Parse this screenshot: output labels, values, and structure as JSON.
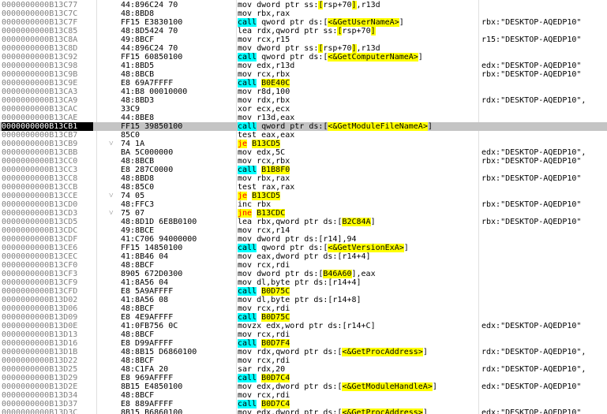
{
  "view": "disassembly",
  "selected_address": "0000000000B13CB1",
  "colors": {
    "call_highlight": "#00ffff",
    "jump_highlight": "#ffff00",
    "selected_row": "#c4c4c4",
    "selected_address_bg": "#000000"
  },
  "rows": [
    {
      "addr": "0000000000B13C77",
      "arrow": "",
      "bytes": "44:896C24 70",
      "instr": [
        {
          "t": "mov dword ptr ss:"
        },
        {
          "t": "[",
          "h": "sbr"
        },
        {
          "t": "rsp+70"
        },
        {
          "t": "]",
          "h": "sbr"
        },
        {
          "t": ",r13d"
        }
      ],
      "comment": ""
    },
    {
      "addr": "0000000000B13C7C",
      "arrow": "",
      "bytes": "48:8BD8",
      "instr": [
        {
          "t": "mov rbx,rax"
        }
      ],
      "comment": ""
    },
    {
      "addr": "0000000000B13C7F",
      "arrow": "",
      "bytes": "FF15 E3830100",
      "instr": [
        {
          "t": "call",
          "h": "call"
        },
        {
          "t": " qword ptr ds:["
        },
        {
          "t": "<&GetUserNameA>",
          "h": "ref"
        },
        {
          "t": "]"
        }
      ],
      "comment": "rbx:\"DESKTOP-AQEDP10\""
    },
    {
      "addr": "0000000000B13C85",
      "arrow": "",
      "bytes": "48:8D5424 70",
      "instr": [
        {
          "t": "lea rdx,qword ptr ss:"
        },
        {
          "t": "[",
          "h": "sbr"
        },
        {
          "t": "rsp+70"
        },
        {
          "t": "]",
          "h": "sbr"
        }
      ],
      "comment": ""
    },
    {
      "addr": "0000000000B13C8A",
      "arrow": "",
      "bytes": "49:8BCF",
      "instr": [
        {
          "t": "mov rcx,r15"
        }
      ],
      "comment": "r15:\"DESKTOP-AQEDP10\""
    },
    {
      "addr": "0000000000B13C8D",
      "arrow": "",
      "bytes": "44:896C24 70",
      "instr": [
        {
          "t": "mov dword ptr ss:"
        },
        {
          "t": "[",
          "h": "sbr"
        },
        {
          "t": "rsp+70"
        },
        {
          "t": "]",
          "h": "sbr"
        },
        {
          "t": ",r13d"
        }
      ],
      "comment": ""
    },
    {
      "addr": "0000000000B13C92",
      "arrow": "",
      "bytes": "FF15 60850100",
      "instr": [
        {
          "t": "call",
          "h": "call"
        },
        {
          "t": " qword ptr ds:["
        },
        {
          "t": "<&GetComputerNameA>",
          "h": "ref"
        },
        {
          "t": "]"
        }
      ],
      "comment": ""
    },
    {
      "addr": "0000000000B13C98",
      "arrow": "",
      "bytes": "41:8BD5",
      "instr": [
        {
          "t": "mov edx,r13d"
        }
      ],
      "comment": "edx:\"DESKTOP-AQEDP10\""
    },
    {
      "addr": "0000000000B13C9B",
      "arrow": "",
      "bytes": "48:8BCB",
      "instr": [
        {
          "t": "mov rcx,rbx"
        }
      ],
      "comment": "rbx:\"DESKTOP-AQEDP10\""
    },
    {
      "addr": "0000000000B13C9E",
      "arrow": "",
      "bytes": "E8 69A7FFFF",
      "instr": [
        {
          "t": "call",
          "h": "call"
        },
        {
          "t": " "
        },
        {
          "t": "B0E40C",
          "h": "ref"
        }
      ],
      "comment": ""
    },
    {
      "addr": "0000000000B13CA3",
      "arrow": "",
      "bytes": "41:B8 00010000",
      "instr": [
        {
          "t": "mov r8d,100"
        }
      ],
      "comment": ""
    },
    {
      "addr": "0000000000B13CA9",
      "arrow": "",
      "bytes": "48:8BD3",
      "instr": [
        {
          "t": "mov rdx,rbx"
        }
      ],
      "comment": "rdx:\"DESKTOP-AQEDP10\","
    },
    {
      "addr": "0000000000B13CAC",
      "arrow": "",
      "bytes": "33C9",
      "instr": [
        {
          "t": "xor ecx,ecx"
        }
      ],
      "comment": ""
    },
    {
      "addr": "0000000000B13CAE",
      "arrow": "",
      "bytes": "44:8BE8",
      "instr": [
        {
          "t": "mov r13d,eax"
        }
      ],
      "comment": ""
    },
    {
      "addr": "0000000000B13CB1",
      "arrow": "",
      "bytes": "FF15 39850100",
      "instr": [
        {
          "t": "call",
          "h": "call"
        },
        {
          "t": " qword ptr ds:["
        },
        {
          "t": "<&GetModuleFileNameA>",
          "h": "ref"
        },
        {
          "t": "]"
        }
      ],
      "comment": "",
      "sel": true
    },
    {
      "addr": "0000000000B13CB7",
      "arrow": "",
      "bytes": "85C0",
      "instr": [
        {
          "t": "test eax,eax"
        }
      ],
      "comment": ""
    },
    {
      "addr": "0000000000B13CB9",
      "arrow": "v",
      "bytes": "74 1A",
      "instr": [
        {
          "t": "je",
          "h": "jmp2"
        },
        {
          "t": " "
        },
        {
          "t": "B13CD5",
          "h": "jmp"
        }
      ],
      "comment": ""
    },
    {
      "addr": "0000000000B13CBB",
      "arrow": "",
      "bytes": "BA 5C000000",
      "instr": [
        {
          "t": "mov edx,5C"
        }
      ],
      "comment": "edx:\"DESKTOP-AQEDP10\","
    },
    {
      "addr": "0000000000B13CC0",
      "arrow": "",
      "bytes": "48:8BCB",
      "instr": [
        {
          "t": "mov rcx,rbx"
        }
      ],
      "comment": "rbx:\"DESKTOP-AQEDP10\""
    },
    {
      "addr": "0000000000B13CC3",
      "arrow": "",
      "bytes": "E8 287C0000",
      "instr": [
        {
          "t": "call",
          "h": "call"
        },
        {
          "t": " "
        },
        {
          "t": "B1B8F0",
          "h": "ref"
        }
      ],
      "comment": ""
    },
    {
      "addr": "0000000000B13CC8",
      "arrow": "",
      "bytes": "48:8BD8",
      "instr": [
        {
          "t": "mov rbx,rax"
        }
      ],
      "comment": "rbx:\"DESKTOP-AQEDP10\""
    },
    {
      "addr": "0000000000B13CCB",
      "arrow": "",
      "bytes": "48:85C0",
      "instr": [
        {
          "t": "test rax,rax"
        }
      ],
      "comment": ""
    },
    {
      "addr": "0000000000B13CCE",
      "arrow": "v",
      "bytes": "74 05",
      "instr": [
        {
          "t": "je",
          "h": "jmp2"
        },
        {
          "t": " "
        },
        {
          "t": "B13CD5",
          "h": "jmp"
        }
      ],
      "comment": ""
    },
    {
      "addr": "0000000000B13CD0",
      "arrow": "",
      "bytes": "48:FFC3",
      "instr": [
        {
          "t": "inc rbx"
        }
      ],
      "comment": "rbx:\"DESKTOP-AQEDP10\""
    },
    {
      "addr": "0000000000B13CD3",
      "arrow": "v",
      "bytes": "75 07",
      "instr": [
        {
          "t": "jne",
          "h": "jmp2"
        },
        {
          "t": " "
        },
        {
          "t": "B13CDC",
          "h": "jmp"
        }
      ],
      "comment": ""
    },
    {
      "addr": "0000000000B13CD5",
      "arrow": "",
      "bytes": "48:8D1D 6E8B0100",
      "instr": [
        {
          "t": "lea rbx,qword ptr ds:["
        },
        {
          "t": "B2C84A",
          "h": "ref"
        },
        {
          "t": "]"
        }
      ],
      "comment": "rbx:\"DESKTOP-AQEDP10\""
    },
    {
      "addr": "0000000000B13CDC",
      "arrow": "",
      "bytes": "49:8BCE",
      "instr": [
        {
          "t": "mov rcx,r14"
        }
      ],
      "comment": ""
    },
    {
      "addr": "0000000000B13CDF",
      "arrow": "",
      "bytes": "41:C706 94000000",
      "instr": [
        {
          "t": "mov dword ptr ds:[r14],94"
        }
      ],
      "comment": ""
    },
    {
      "addr": "0000000000B13CE6",
      "arrow": "",
      "bytes": "FF15 14850100",
      "instr": [
        {
          "t": "call",
          "h": "call"
        },
        {
          "t": " qword ptr ds:["
        },
        {
          "t": "<&GetVersionExA>",
          "h": "ref"
        },
        {
          "t": "]"
        }
      ],
      "comment": ""
    },
    {
      "addr": "0000000000B13CEC",
      "arrow": "",
      "bytes": "41:8B46 04",
      "instr": [
        {
          "t": "mov eax,dword ptr ds:[r14+4]"
        }
      ],
      "comment": ""
    },
    {
      "addr": "0000000000B13CF0",
      "arrow": "",
      "bytes": "48:8BCF",
      "instr": [
        {
          "t": "mov rcx,rdi"
        }
      ],
      "comment": ""
    },
    {
      "addr": "0000000000B13CF3",
      "arrow": "",
      "bytes": "8905 672D0300",
      "instr": [
        {
          "t": "mov dword ptr ds:["
        },
        {
          "t": "B46A60",
          "h": "ref"
        },
        {
          "t": "],eax"
        }
      ],
      "comment": ""
    },
    {
      "addr": "0000000000B13CF9",
      "arrow": "",
      "bytes": "41:8A56 04",
      "instr": [
        {
          "t": "mov dl,byte ptr ds:[r14+4]"
        }
      ],
      "comment": ""
    },
    {
      "addr": "0000000000B13CFD",
      "arrow": "",
      "bytes": "E8 5A9AFFFF",
      "instr": [
        {
          "t": "call",
          "h": "call"
        },
        {
          "t": " "
        },
        {
          "t": "B0D75C",
          "h": "ref"
        }
      ],
      "comment": ""
    },
    {
      "addr": "0000000000B13D02",
      "arrow": "",
      "bytes": "41:8A56 08",
      "instr": [
        {
          "t": "mov dl,byte ptr ds:[r14+8]"
        }
      ],
      "comment": ""
    },
    {
      "addr": "0000000000B13D06",
      "arrow": "",
      "bytes": "48:8BCF",
      "instr": [
        {
          "t": "mov rcx,rdi"
        }
      ],
      "comment": ""
    },
    {
      "addr": "0000000000B13D09",
      "arrow": "",
      "bytes": "E8 4E9AFFFF",
      "instr": [
        {
          "t": "call",
          "h": "call"
        },
        {
          "t": " "
        },
        {
          "t": "B0D75C",
          "h": "ref"
        }
      ],
      "comment": ""
    },
    {
      "addr": "0000000000B13D0E",
      "arrow": "",
      "bytes": "41:0FB756 0C",
      "instr": [
        {
          "t": "movzx edx,word ptr ds:[r14+C]"
        }
      ],
      "comment": "edx:\"DESKTOP-AQEDP10\""
    },
    {
      "addr": "0000000000B13D13",
      "arrow": "",
      "bytes": "48:8BCF",
      "instr": [
        {
          "t": "mov rcx,rdi"
        }
      ],
      "comment": ""
    },
    {
      "addr": "0000000000B13D16",
      "arrow": "",
      "bytes": "E8 D99AFFFF",
      "instr": [
        {
          "t": "call",
          "h": "call"
        },
        {
          "t": " "
        },
        {
          "t": "B0D7F4",
          "h": "ref"
        }
      ],
      "comment": ""
    },
    {
      "addr": "0000000000B13D1B",
      "arrow": "",
      "bytes": "48:8B15 D6860100",
      "instr": [
        {
          "t": "mov rdx,qword ptr ds:["
        },
        {
          "t": "<&GetProcAddress>",
          "h": "ref"
        },
        {
          "t": "]"
        }
      ],
      "comment": "rdx:\"DESKTOP-AQEDP10\","
    },
    {
      "addr": "0000000000B13D22",
      "arrow": "",
      "bytes": "48:8BCF",
      "instr": [
        {
          "t": "mov rcx,rdi"
        }
      ],
      "comment": ""
    },
    {
      "addr": "0000000000B13D25",
      "arrow": "",
      "bytes": "48:C1FA 20",
      "instr": [
        {
          "t": "sar rdx,20"
        }
      ],
      "comment": "rdx:\"DESKTOP-AQEDP10\","
    },
    {
      "addr": "0000000000B13D29",
      "arrow": "",
      "bytes": "E8 969AFFFF",
      "instr": [
        {
          "t": "call",
          "h": "call"
        },
        {
          "t": " "
        },
        {
          "t": "B0D7C4",
          "h": "ref"
        }
      ],
      "comment": ""
    },
    {
      "addr": "0000000000B13D2E",
      "arrow": "",
      "bytes": "8B15 E4850100",
      "instr": [
        {
          "t": "mov edx,dword ptr ds:["
        },
        {
          "t": "<&GetModuleHandleA>",
          "h": "ref"
        },
        {
          "t": "]"
        }
      ],
      "comment": "edx:\"DESKTOP-AQEDP10\""
    },
    {
      "addr": "0000000000B13D34",
      "arrow": "",
      "bytes": "48:8BCF",
      "instr": [
        {
          "t": "mov rcx,rdi"
        }
      ],
      "comment": ""
    },
    {
      "addr": "0000000000B13D37",
      "arrow": "",
      "bytes": "E8 889AFFFF",
      "instr": [
        {
          "t": "call",
          "h": "call"
        },
        {
          "t": " "
        },
        {
          "t": "B0D7C4",
          "h": "ref"
        }
      ],
      "comment": ""
    },
    {
      "addr": "0000000000B13D3C",
      "arrow": "",
      "bytes": "8B15 B6860100",
      "instr": [
        {
          "t": "mov edx,dword ptr ds:["
        },
        {
          "t": "<&GetProcAddress>",
          "h": "ref"
        },
        {
          "t": "]"
        }
      ],
      "comment": "edx:\"DESKTOP-AQEDP10\""
    }
  ]
}
